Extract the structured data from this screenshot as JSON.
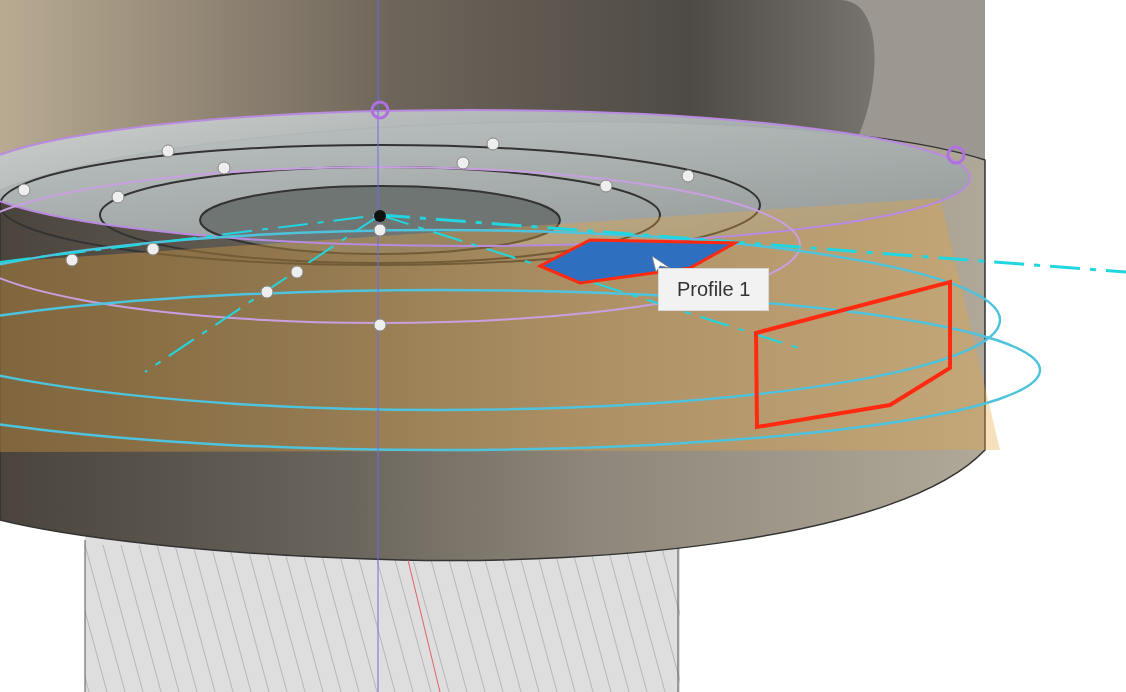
{
  "tooltip": {
    "text": "Profile 1"
  }
}
